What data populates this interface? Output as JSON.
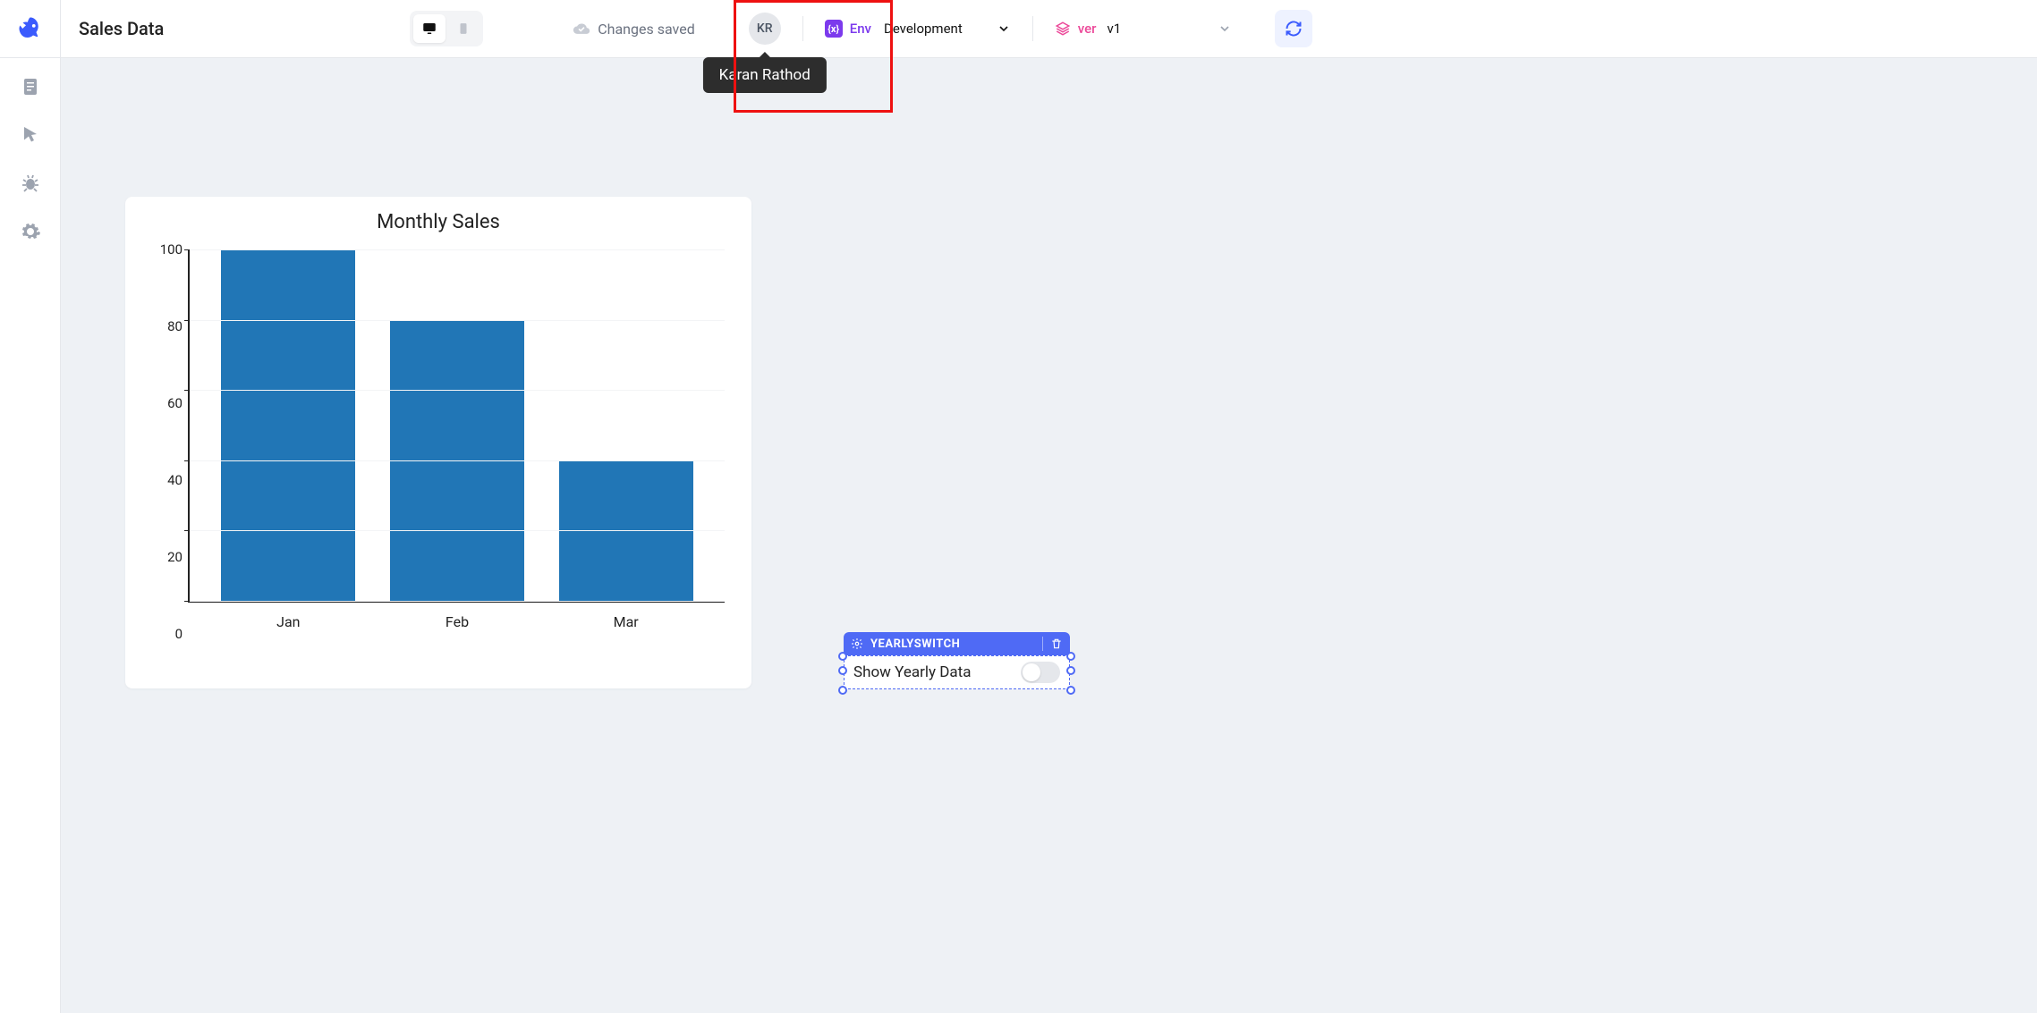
{
  "header": {
    "app_title": "Sales Data",
    "save_status": "Changes saved",
    "avatar_initials": "KR",
    "avatar_tooltip": "Karan Rathod",
    "env_label": "Env",
    "env_value": "Development",
    "ver_label": "ver",
    "ver_value": "v1"
  },
  "sidebar": {
    "items": [
      "page-icon",
      "cursor-icon",
      "bug-icon",
      "gear-icon"
    ]
  },
  "switch_widget": {
    "name": "YEARLYSWITCH",
    "label": "Show Yearly Data",
    "on": false
  },
  "chart_data": {
    "type": "bar",
    "title": "Monthly Sales",
    "categories": [
      "Jan",
      "Feb",
      "Mar"
    ],
    "values": [
      100,
      80,
      40
    ],
    "xlabel": "",
    "ylabel": "",
    "ylim": [
      0,
      100
    ],
    "yticks": [
      0,
      20,
      40,
      60,
      80,
      100
    ]
  }
}
